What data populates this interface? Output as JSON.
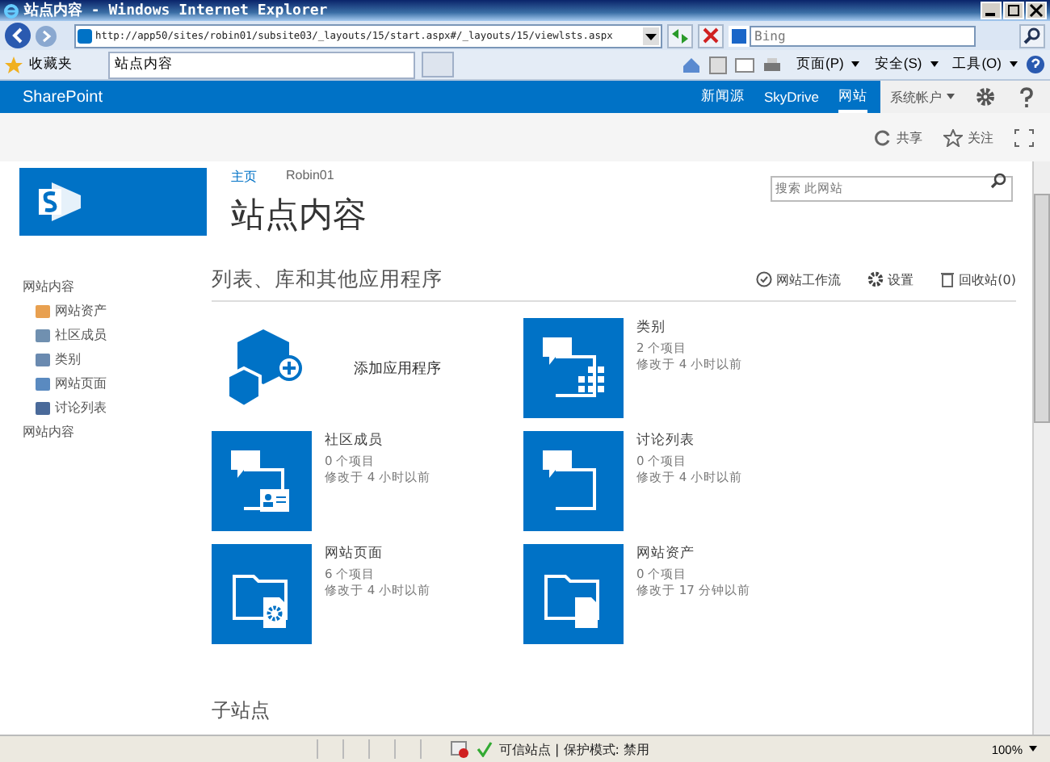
{
  "window": {
    "title": "站点内容 - Windows Internet Explorer"
  },
  "browser": {
    "address": "http://app50/sites/robin01/subsite03/_layouts/15/start.aspx#/_layouts/15/viewlsts.aspx",
    "search_placeholder": "Bing",
    "favorites": "收藏夹",
    "tab": "站点内容",
    "menus": [
      "页面(P)",
      "安全(S)",
      "工具(O)"
    ]
  },
  "suite_bar": {
    "brand": "SharePoint",
    "links": [
      {
        "label": "新闻源",
        "selected": false
      },
      {
        "label": "SkyDrive",
        "selected": false
      },
      {
        "label": "网站",
        "selected": true
      }
    ],
    "user": "系统帐户"
  },
  "ribbon": {
    "actions": [
      "共享",
      "关注"
    ]
  },
  "breadcrumb": [
    "主页",
    "Robin01"
  ],
  "search": {
    "placeholder": "搜索 此网站"
  },
  "page_title": "站点内容",
  "left_nav": [
    {
      "label": "网站内容",
      "children": [
        {
          "label": "网站资产"
        },
        {
          "label": "社区成员"
        },
        {
          "label": "类别"
        },
        {
          "label": "网站页面"
        },
        {
          "label": "讨论列表"
        }
      ]
    },
    {
      "label": "网站内容"
    }
  ],
  "section": {
    "heading": "列表、库和其他应用程序",
    "actions": [
      "网站工作流",
      "设置",
      "回收站(0)"
    ]
  },
  "apps": [
    {
      "kind": "add",
      "title": "添加应用程序"
    },
    {
      "kind": "list",
      "title": "类别",
      "count": "2 个项目",
      "modified": "修改于 4 小时以前"
    },
    {
      "kind": "list",
      "title": "社区成员",
      "count": "0 个项目",
      "modified": "修改于 4 小时以前"
    },
    {
      "kind": "list",
      "title": "讨论列表",
      "count": "0 个项目",
      "modified": "修改于 4 小时以前"
    },
    {
      "kind": "list",
      "title": "网站页面",
      "count": "6 个项目",
      "modified": "修改于 4 小时以前"
    },
    {
      "kind": "list",
      "title": "网站资产",
      "count": "0 个项目",
      "modified": "修改于 17 分钟以前"
    }
  ],
  "subsites_heading": "子站点",
  "status_bar": {
    "zone": "可信站点 | 保护模式: 禁用",
    "zoom": "100%"
  }
}
